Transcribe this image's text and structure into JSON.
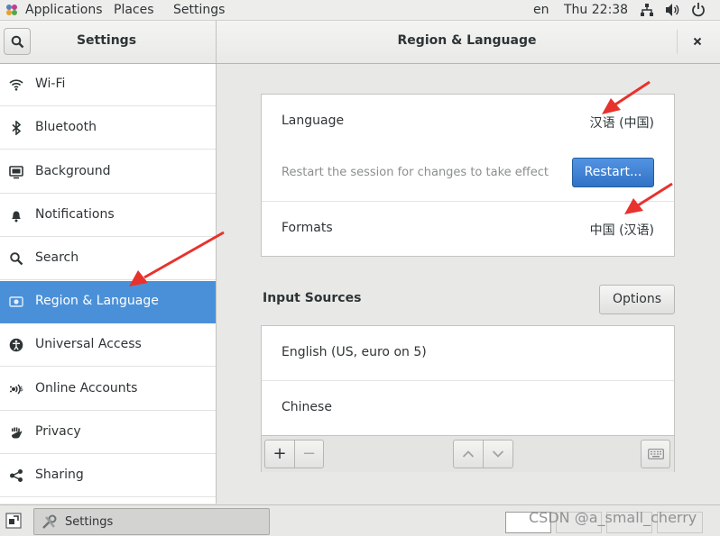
{
  "topbar": {
    "applications": "Applications",
    "places": "Places",
    "settings": "Settings",
    "input_lang": "en",
    "clock": "Thu 22:38"
  },
  "headerbar": {
    "left_title": "Settings",
    "title": "Region & Language"
  },
  "sidebar": {
    "items": [
      {
        "label": "Wi-Fi",
        "icon": "wifi-icon"
      },
      {
        "label": "Bluetooth",
        "icon": "bluetooth-icon"
      },
      {
        "label": "Background",
        "icon": "background-icon"
      },
      {
        "label": "Notifications",
        "icon": "bell-icon"
      },
      {
        "label": "Search",
        "icon": "search-icon"
      },
      {
        "label": "Region & Language",
        "icon": "region-icon",
        "selected": true
      },
      {
        "label": "Universal Access",
        "icon": "accessibility-icon"
      },
      {
        "label": "Online Accounts",
        "icon": "online-accounts-icon"
      },
      {
        "label": "Privacy",
        "icon": "hand-icon"
      },
      {
        "label": "Sharing",
        "icon": "share-icon"
      }
    ]
  },
  "language_panel": {
    "language_label": "Language",
    "language_value": "汉语 (中国)",
    "restart_note": "Restart the session for changes to take effect",
    "restart_button": "Restart...",
    "formats_label": "Formats",
    "formats_value": "中国 (汉语)"
  },
  "input_sources": {
    "title": "Input Sources",
    "options_button": "Options",
    "sources": [
      "English (US, euro on 5)",
      "Chinese"
    ],
    "add_label": "+",
    "remove_label": "−"
  },
  "taskbar": {
    "window_label": "Settings"
  },
  "watermark": "CSDN @a_small_cherry",
  "colors": {
    "accent": "#4a90d9",
    "annotation_arrow": "#e8322d"
  }
}
